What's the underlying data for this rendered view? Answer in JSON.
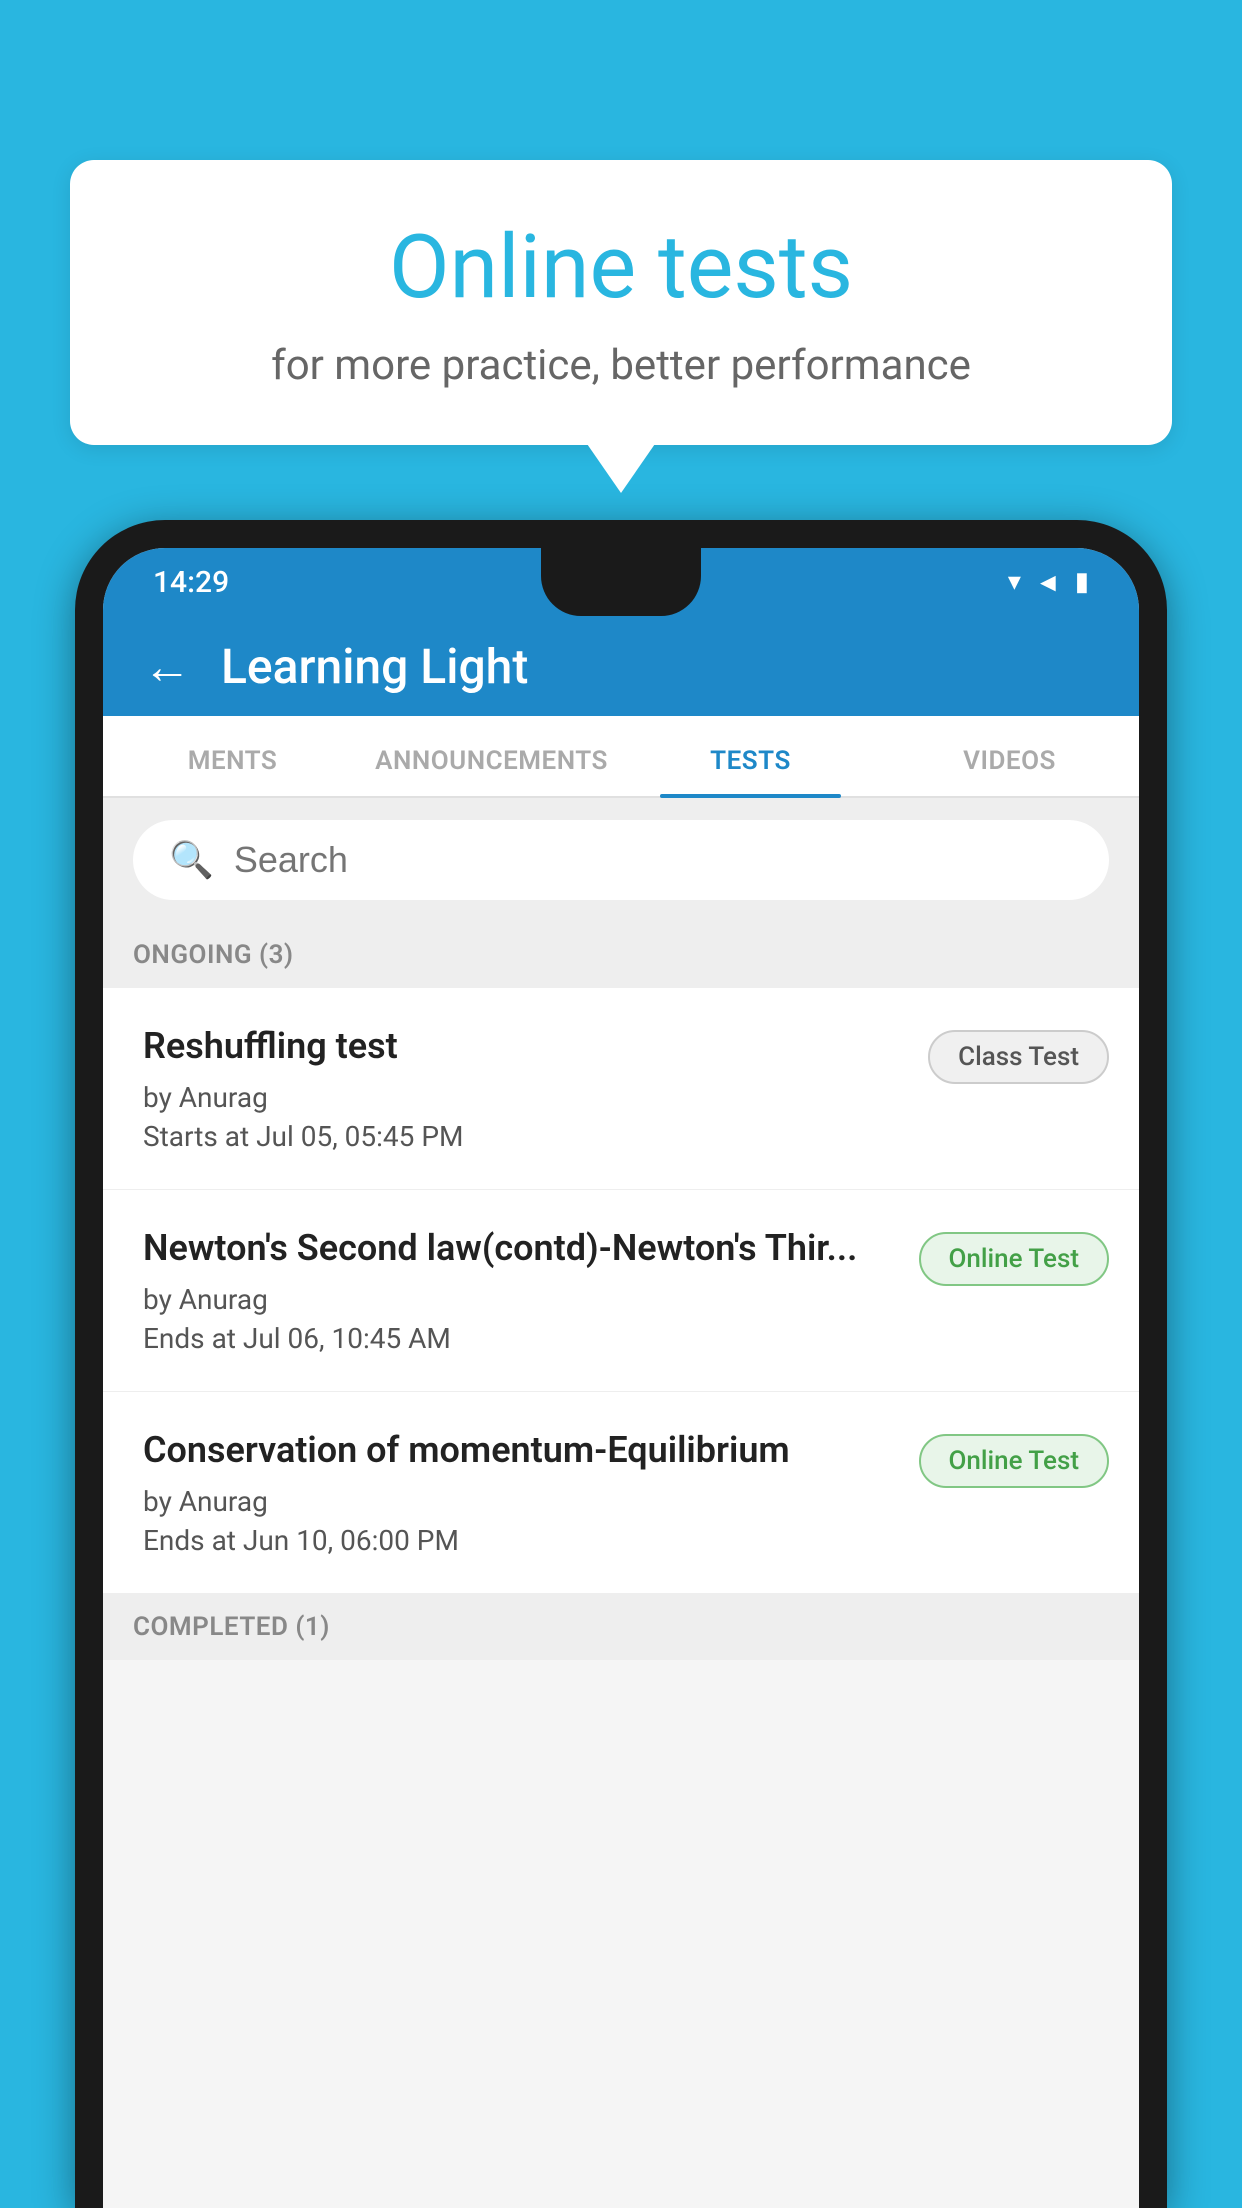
{
  "background_color": "#29b6e0",
  "speech_bubble": {
    "title": "Online tests",
    "subtitle": "for more practice, better performance"
  },
  "status_bar": {
    "time": "14:29",
    "icons": [
      "wifi",
      "signal",
      "battery"
    ]
  },
  "header": {
    "title": "Learning Light",
    "back_label": "←"
  },
  "tabs": [
    {
      "label": "MENTS",
      "active": false
    },
    {
      "label": "ANNOUNCEMENTS",
      "active": false
    },
    {
      "label": "TESTS",
      "active": true
    },
    {
      "label": "VIDEOS",
      "active": false
    }
  ],
  "search": {
    "placeholder": "Search"
  },
  "sections": [
    {
      "label": "ONGOING (3)",
      "items": [
        {
          "name": "Reshuffling test",
          "by": "by Anurag",
          "date": "Starts at  Jul 05, 05:45 PM",
          "badge": "Class Test",
          "badge_type": "class"
        },
        {
          "name": "Newton's Second law(contd)-Newton's Thir...",
          "by": "by Anurag",
          "date": "Ends at  Jul 06, 10:45 AM",
          "badge": "Online Test",
          "badge_type": "online"
        },
        {
          "name": "Conservation of momentum-Equilibrium",
          "by": "by Anurag",
          "date": "Ends at  Jun 10, 06:00 PM",
          "badge": "Online Test",
          "badge_type": "online"
        }
      ]
    }
  ],
  "completed_label": "COMPLETED (1)"
}
